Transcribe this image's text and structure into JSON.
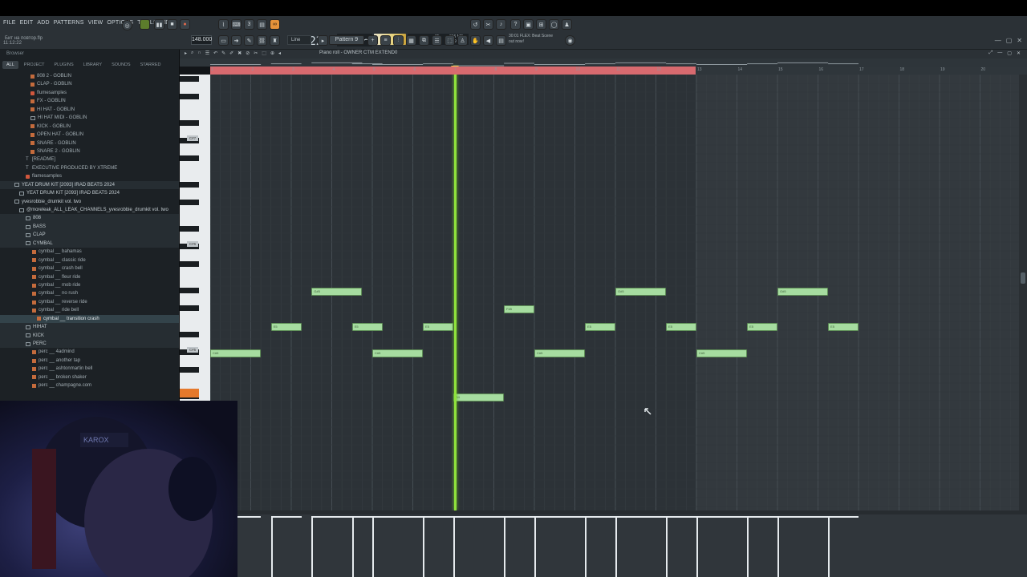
{
  "menu": [
    "FILE",
    "EDIT",
    "ADD",
    "PATTERNS",
    "VIEW",
    "OPTIONS",
    "TOOLS",
    "HELP"
  ],
  "hint": {
    "line1": "Бит на повтор.flp",
    "line2": "11:12:22"
  },
  "transport": {
    "tempo": "148.000",
    "time_main": "0:22:",
    "time_sub": "86"
  },
  "cpu": {
    "v1": "25",
    "v2": "696 MB",
    "v3": "9"
  },
  "toolbar": {
    "snap": "Line",
    "pattern": "Pattern 9"
  },
  "news": {
    "line1": "30:01 FLEX: Beat Scene",
    "line2": "out now!"
  },
  "browser": {
    "title": "Browser",
    "tabs": [
      "ALL",
      "PROJECT",
      "PLUGINS",
      "LIBRARY",
      "SOUNDS",
      "STARRED"
    ],
    "items": [
      {
        "label": "808 2 - GOBLIN",
        "icon": "f",
        "indent": 38
      },
      {
        "label": "CLAP - GOBLIN",
        "icon": "f",
        "indent": 38
      },
      {
        "label": "flumesamples",
        "icon": "s",
        "indent": 38
      },
      {
        "label": "FX - GOBLIN",
        "icon": "f",
        "indent": 38
      },
      {
        "label": "HI HAT - GOBLIN",
        "icon": "f",
        "indent": 38
      },
      {
        "label": "HI HAT MIDI - GOBLIN",
        "icon": "d",
        "indent": 38
      },
      {
        "label": "KICK - GOBLIN",
        "icon": "f",
        "indent": 38
      },
      {
        "label": "OPEN HAT - GOBLIN",
        "icon": "f",
        "indent": 38
      },
      {
        "label": "SNARE - GOBLIN",
        "icon": "f",
        "indent": 38
      },
      {
        "label": "SNARE 2 - GOBLIN",
        "icon": "f",
        "indent": 38
      },
      {
        "label": "[README]",
        "icon": "t",
        "indent": 32
      },
      {
        "label": "EXECUTIVE PRODUCED BY XTREME",
        "icon": "t",
        "indent": 32
      },
      {
        "label": "flamesamples",
        "icon": "s",
        "indent": 32
      },
      {
        "label": "YEAT DRUM KIT [2093] IRAD BEATS 2024",
        "icon": "d",
        "indent": 18,
        "folder": true,
        "hl": true
      },
      {
        "label": "YEAT DRUM KIT [2093] IRAD BEATS 2024",
        "icon": "d",
        "indent": 24,
        "folder": true
      },
      {
        "label": "yvesrobbie_drumkit vol. two",
        "icon": "d",
        "indent": 18,
        "folder": true
      },
      {
        "label": "@moreleak_ALL_LEAK_CHANNELS_yvesrobbie_drumkit vol. two",
        "icon": "d",
        "indent": 24,
        "folder": true
      },
      {
        "label": "808",
        "icon": "d",
        "indent": 32,
        "folder": true,
        "hl": true
      },
      {
        "label": "BASS",
        "icon": "d",
        "indent": 32,
        "folder": true,
        "hl": true
      },
      {
        "label": "CLAP",
        "icon": "d",
        "indent": 32,
        "folder": true,
        "hl": true
      },
      {
        "label": "CYMBAL",
        "icon": "d",
        "indent": 32,
        "folder": true,
        "hl": true
      },
      {
        "label": "cymbal __ bahamas",
        "icon": "f",
        "indent": 40
      },
      {
        "label": "cymbal __ classic ride",
        "icon": "f",
        "indent": 40
      },
      {
        "label": "cymbal __ crash bell",
        "icon": "f",
        "indent": 40
      },
      {
        "label": "cymbal __ fleur ride",
        "icon": "f",
        "indent": 40
      },
      {
        "label": "cymbal __ mob ride",
        "icon": "f",
        "indent": 40
      },
      {
        "label": "cymbal __ no rush",
        "icon": "f",
        "indent": 40
      },
      {
        "label": "cymbal __ reverse ride",
        "icon": "f",
        "indent": 40
      },
      {
        "label": "cymbal __ ride bell",
        "icon": "f",
        "indent": 40
      },
      {
        "label": "cymbal __ transition crash",
        "icon": "f",
        "indent": 46,
        "sel": true
      },
      {
        "label": "HIHAT",
        "icon": "d",
        "indent": 32,
        "folder": true,
        "hl": true
      },
      {
        "label": "KICK",
        "icon": "d",
        "indent": 32,
        "folder": true,
        "hl": true
      },
      {
        "label": "PERC",
        "icon": "d",
        "indent": 32,
        "folder": true,
        "hl": true
      },
      {
        "label": "perc __ 4admind",
        "icon": "f",
        "indent": 40
      },
      {
        "label": "perc __ another tap",
        "icon": "f",
        "indent": 40
      },
      {
        "label": "perc __ ashtonmartin bell",
        "icon": "f",
        "indent": 40
      },
      {
        "label": "perc __ broken shaker",
        "icon": "f",
        "indent": 40
      },
      {
        "label": "perc __ champagne.com",
        "icon": "f",
        "indent": 40
      }
    ]
  },
  "piano_roll": {
    "title": "Piano roll - OWNER CTM EXTEND0",
    "bars": [
      "1",
      "2",
      "3",
      "4",
      "5",
      "6",
      "7",
      "8",
      "9",
      "10",
      "11",
      "12",
      "13",
      "14",
      "15",
      "16",
      "17",
      "18",
      "19",
      "20"
    ],
    "key_labels": [
      "C#7",
      "C#6",
      "C#5"
    ],
    "notes": [
      {
        "label": "C#5",
        "bar": 1,
        "beat": 0,
        "len": 1.25,
        "pitch": 0
      },
      {
        "label": "E5",
        "bar": 2,
        "beat": 0.5,
        "len": 0.75,
        "pitch": 3
      },
      {
        "label": "G#5",
        "bar": 3,
        "beat": 0.5,
        "len": 1.25,
        "pitch": 7
      },
      {
        "label": "E5",
        "bar": 4,
        "beat": 0.5,
        "len": 0.75,
        "pitch": 3
      },
      {
        "label": "C#5",
        "bar": 5,
        "beat": 0,
        "len": 1.25,
        "pitch": 0
      },
      {
        "label": "E5",
        "bar": 6,
        "beat": 0.25,
        "len": 0.75,
        "pitch": 3
      },
      {
        "label": "B4",
        "bar": 7,
        "beat": 0,
        "len": 1.25,
        "pitch": -5
      },
      {
        "label": "F#5",
        "bar": 8,
        "beat": 0.25,
        "len": 0.75,
        "pitch": 5
      },
      {
        "label": "C#5",
        "bar": 9,
        "beat": 0,
        "len": 1.25,
        "pitch": 0
      },
      {
        "label": "E5",
        "bar": 10,
        "beat": 0.25,
        "len": 0.75,
        "pitch": 3
      },
      {
        "label": "G#5",
        "bar": 11,
        "beat": 0,
        "len": 1.25,
        "pitch": 7
      },
      {
        "label": "E5",
        "bar": 12,
        "beat": 0.25,
        "len": 0.75,
        "pitch": 3
      },
      {
        "label": "C#5",
        "bar": 13,
        "beat": 0,
        "len": 1.25,
        "pitch": 0
      },
      {
        "label": "E5",
        "bar": 14,
        "beat": 0.25,
        "len": 0.75,
        "pitch": 3
      },
      {
        "label": "G#5",
        "bar": 15,
        "beat": 0,
        "len": 1.25,
        "pitch": 7
      },
      {
        "label": "E5",
        "bar": 16,
        "beat": 0.25,
        "len": 0.75,
        "pitch": 3
      }
    ]
  },
  "colors": {
    "note": "#a6dca0",
    "playhead": "#8fe23c",
    "loop": "#d86a6f",
    "accent": "#e5923a"
  }
}
